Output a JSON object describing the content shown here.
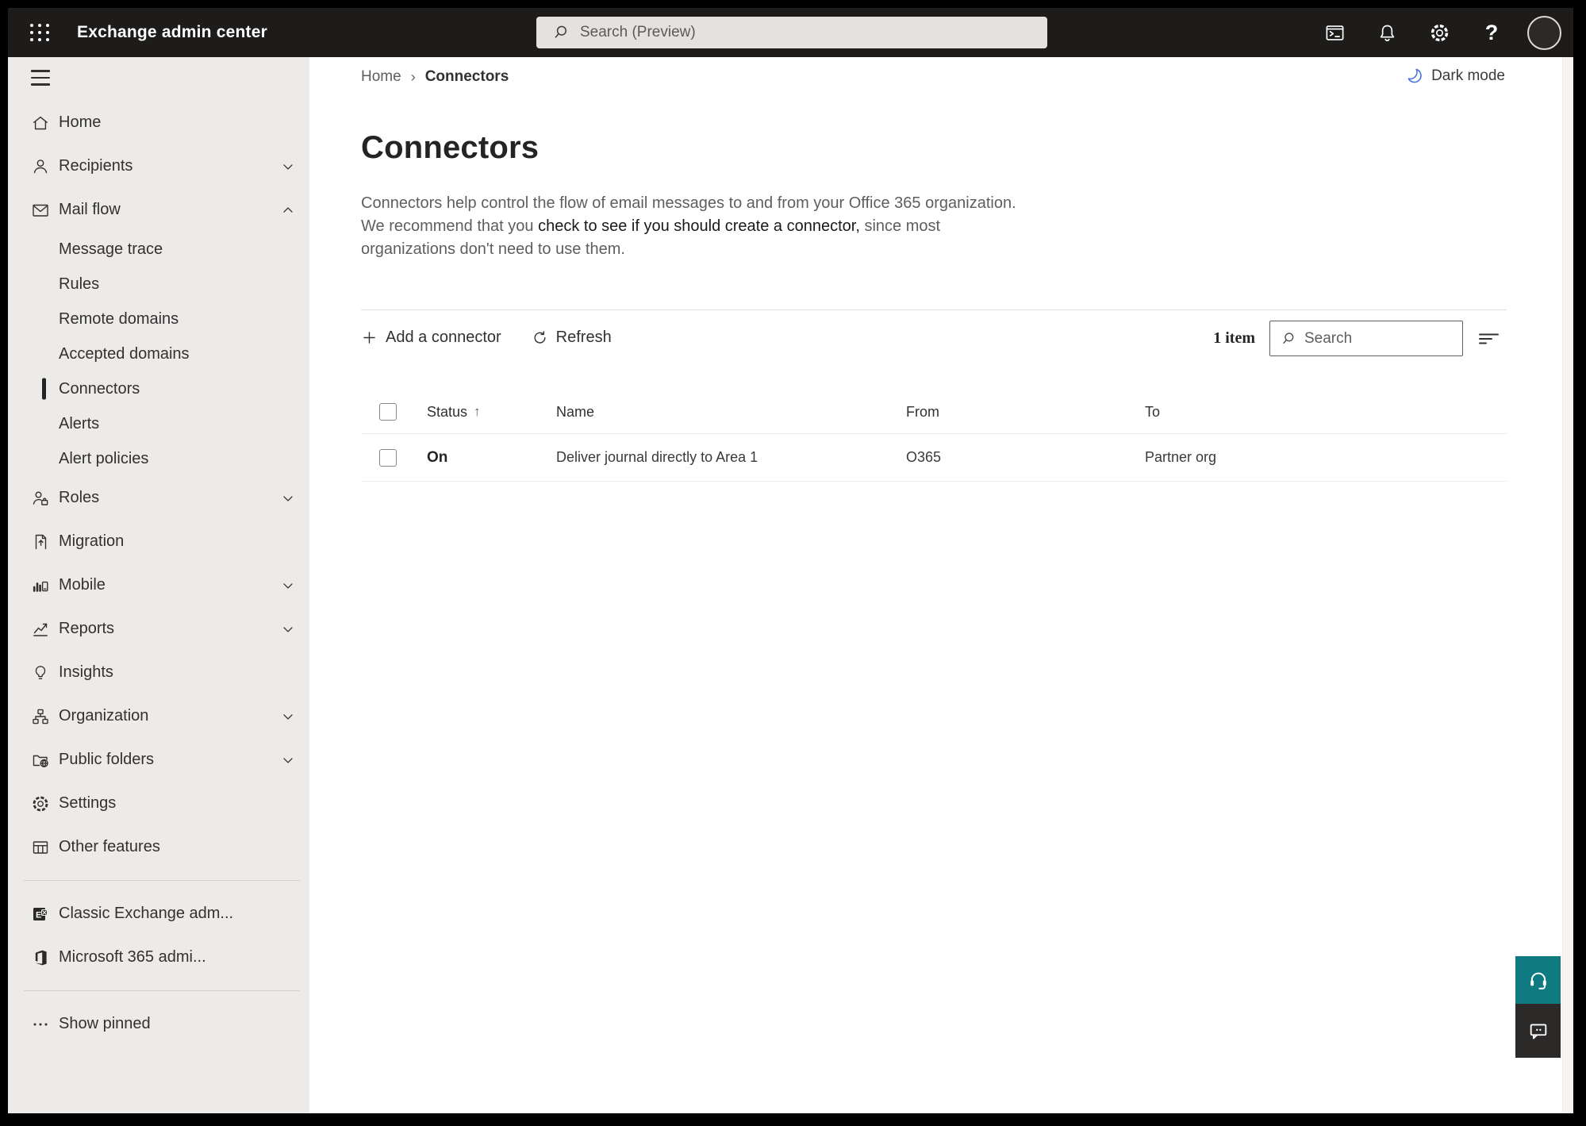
{
  "topbar": {
    "title": "Exchange admin center",
    "search_placeholder": "Search (Preview)"
  },
  "breadcrumb": {
    "items": [
      "Home",
      "Connectors"
    ],
    "separator": "›"
  },
  "dark_mode": {
    "label": "Dark mode"
  },
  "page": {
    "title": "Connectors",
    "description_1": "Connectors help control the flow of email messages to and from your Office 365 organization. We recommend that you ",
    "description_emphasis": "check to see if you should create a connector,",
    "description_2": " since most organizations don't need to use them."
  },
  "toolbar": {
    "add_label": "Add a connector",
    "refresh_label": "Refresh",
    "count_label": "1 item",
    "search_placeholder": "Search"
  },
  "table": {
    "columns": [
      "Status",
      "Name",
      "From",
      "To"
    ],
    "sort_icon": "↑",
    "rows": [
      {
        "status": "On",
        "name": "Deliver journal directly to Area 1",
        "from": "O365",
        "to": "Partner org"
      }
    ]
  },
  "sidebar": {
    "items": [
      {
        "label": "Home"
      },
      {
        "label": "Recipients"
      },
      {
        "label": "Mail flow"
      },
      {
        "label": "Message trace"
      },
      {
        "label": "Rules"
      },
      {
        "label": "Remote domains"
      },
      {
        "label": "Accepted domains"
      },
      {
        "label": "Connectors",
        "selected": true
      },
      {
        "label": "Alerts"
      },
      {
        "label": "Alert policies"
      },
      {
        "label": "Roles"
      },
      {
        "label": "Migration"
      },
      {
        "label": "Mobile"
      },
      {
        "label": "Reports"
      },
      {
        "label": "Insights"
      },
      {
        "label": "Organization"
      },
      {
        "label": "Public folders"
      },
      {
        "label": "Settings"
      },
      {
        "label": "Other features"
      },
      {
        "label": "Classic Exchange adm..."
      },
      {
        "label": "Microsoft 365 admi..."
      },
      {
        "label": "Show pinned"
      }
    ]
  },
  "colors": {
    "topbar_bg": "#1d1c1b",
    "sidebar_bg": "#edebe9",
    "selected_indicator": "#242424",
    "dark_mode_moon": "#4876d9",
    "help_button_teal": "#0f7b81",
    "feedback_button_dark": "#2b2a29"
  }
}
